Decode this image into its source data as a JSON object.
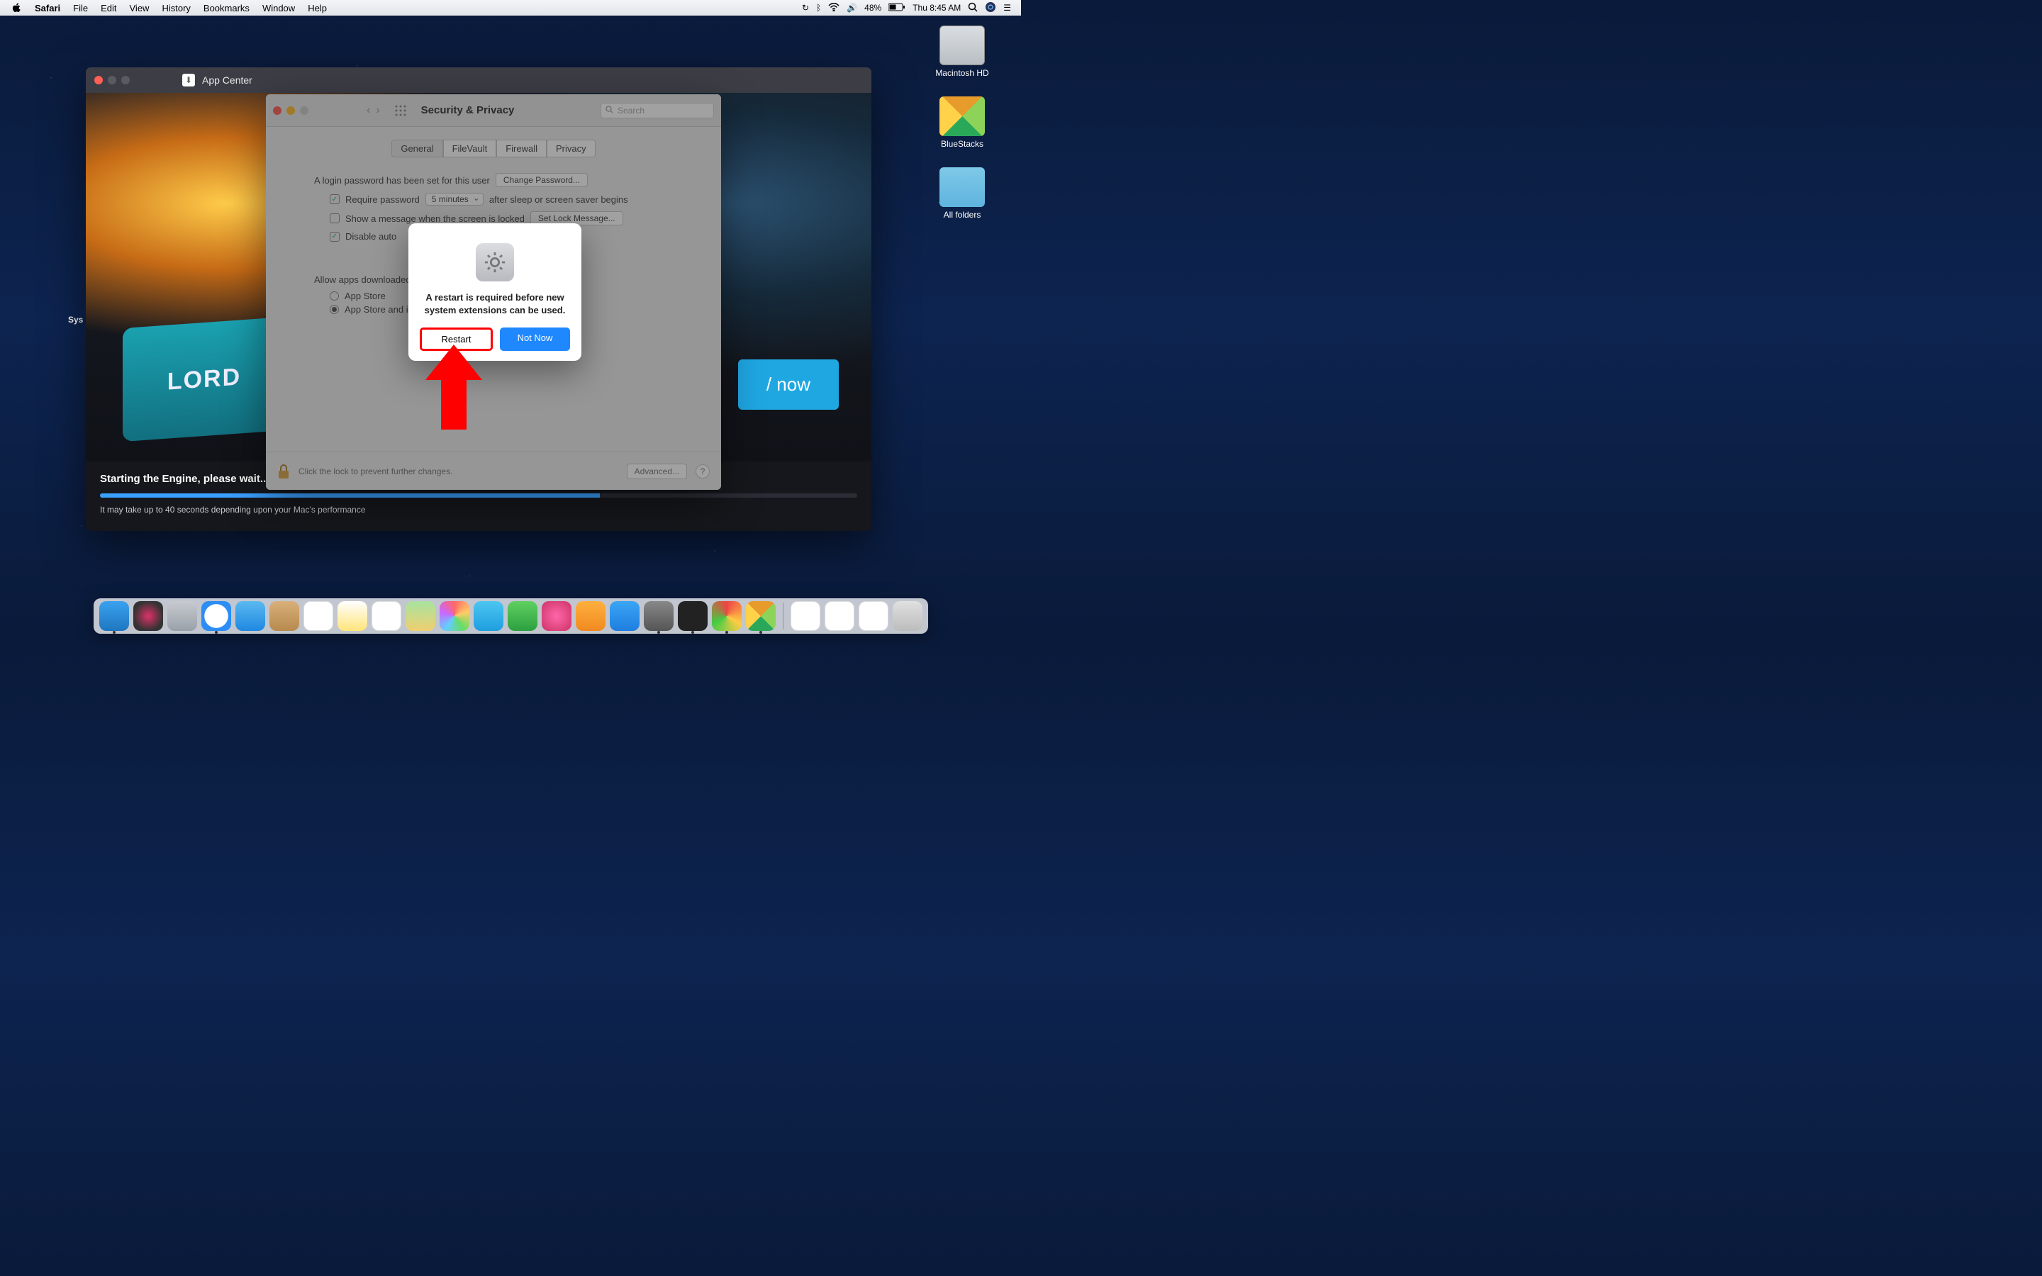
{
  "menubar": {
    "app": "Safari",
    "items": [
      "File",
      "Edit",
      "View",
      "History",
      "Bookmarks",
      "Window",
      "Help"
    ],
    "battery": "48%",
    "clock": "Thu 8:45 AM"
  },
  "desktop": {
    "hd": "Macintosh HD",
    "bluestacks": "BlueStacks",
    "folders": "All folders",
    "truncated": "Sys"
  },
  "appcenter": {
    "title": "App Center",
    "logo_text": "LORD\nMOBILE",
    "play_label": "/ now",
    "status_title": "Starting the Engine, please wait...",
    "status_hint": "It may take up to 40 seconds depending upon your Mac's performance",
    "progress_pct": 66
  },
  "prefs": {
    "title": "Security & Privacy",
    "search_placeholder": "Search",
    "tabs": [
      "General",
      "FileVault",
      "Firewall",
      "Privacy"
    ],
    "pw_set": "A login password has been set for this user",
    "change_pw": "Change Password...",
    "require_pw": "Require password",
    "delay": "5 minutes",
    "after": "after sleep or screen saver begins",
    "show_msg": "Show a message when the screen is locked",
    "set_msg": "Set Lock Message...",
    "disable_auto": "Disable auto",
    "allow_label": "Allow apps downloaded from:",
    "radio1": "App Store",
    "radio2": "App Store and identified developers",
    "lock_hint": "Click the lock to prevent further changes.",
    "advanced": "Advanced...",
    "q": "?"
  },
  "dialog": {
    "message": "A restart is required before new system extensions can be used.",
    "restart": "Restart",
    "not_now": "Not Now"
  }
}
